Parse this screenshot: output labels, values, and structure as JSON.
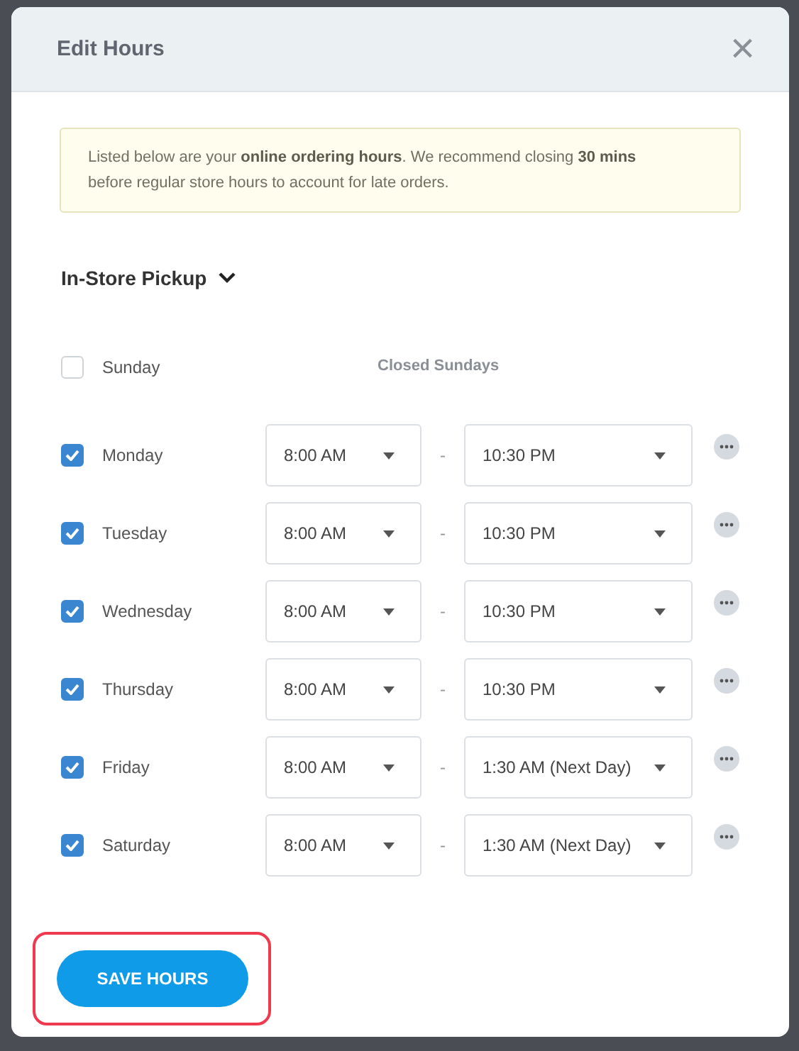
{
  "dialog": {
    "title": "Edit Hours",
    "close": "×"
  },
  "notice": "Listed below are your **online ordering hours**. We recommend closing **30 mins** before regular store hours to account for late orders.",
  "section": {
    "label": "In-Store Pickup",
    "expanded": true
  },
  "days": [
    {
      "name": "Sunday",
      "checked": false,
      "closed_note": "Closed Sundays"
    },
    {
      "name": "Monday",
      "checked": true,
      "open": "8:00 AM",
      "close": "10:30 PM"
    },
    {
      "name": "Tuesday",
      "checked": true,
      "open": "8:00 AM",
      "close": "10:30 PM"
    },
    {
      "name": "Wednesday",
      "checked": true,
      "open": "8:00 AM",
      "close": "10:30 PM"
    },
    {
      "name": "Thursday",
      "checked": true,
      "open": "8:00 AM",
      "close": "10:30 PM"
    },
    {
      "name": "Friday",
      "checked": true,
      "open": "8:00 AM",
      "close": "1:30 AM (Next Day)"
    },
    {
      "name": "Saturday",
      "checked": true,
      "open": "8:00 AM",
      "close": "1:30 AM (Next Day)"
    }
  ],
  "range_separator": "-",
  "save_button": {
    "label": "SAVE HOURS",
    "highlighted": true
  }
}
